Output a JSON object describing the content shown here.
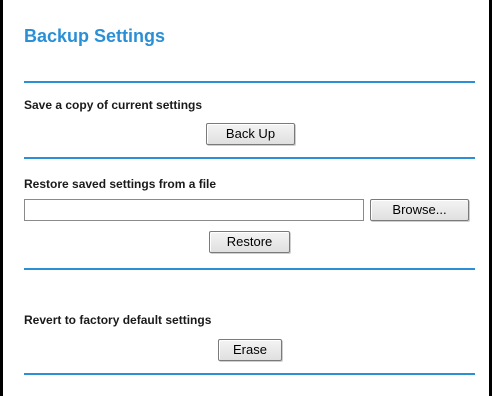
{
  "title": "Backup Settings",
  "backup": {
    "label": "Save a copy of current settings",
    "button": "Back Up"
  },
  "restore": {
    "label": "Restore saved settings from a file",
    "file_value": "",
    "browse_button": "Browse...",
    "button": "Restore"
  },
  "erase": {
    "label": "Revert to factory default settings",
    "button": "Erase"
  },
  "colors": {
    "accent": "#2b8fd6",
    "text": "#1a1a1a"
  }
}
